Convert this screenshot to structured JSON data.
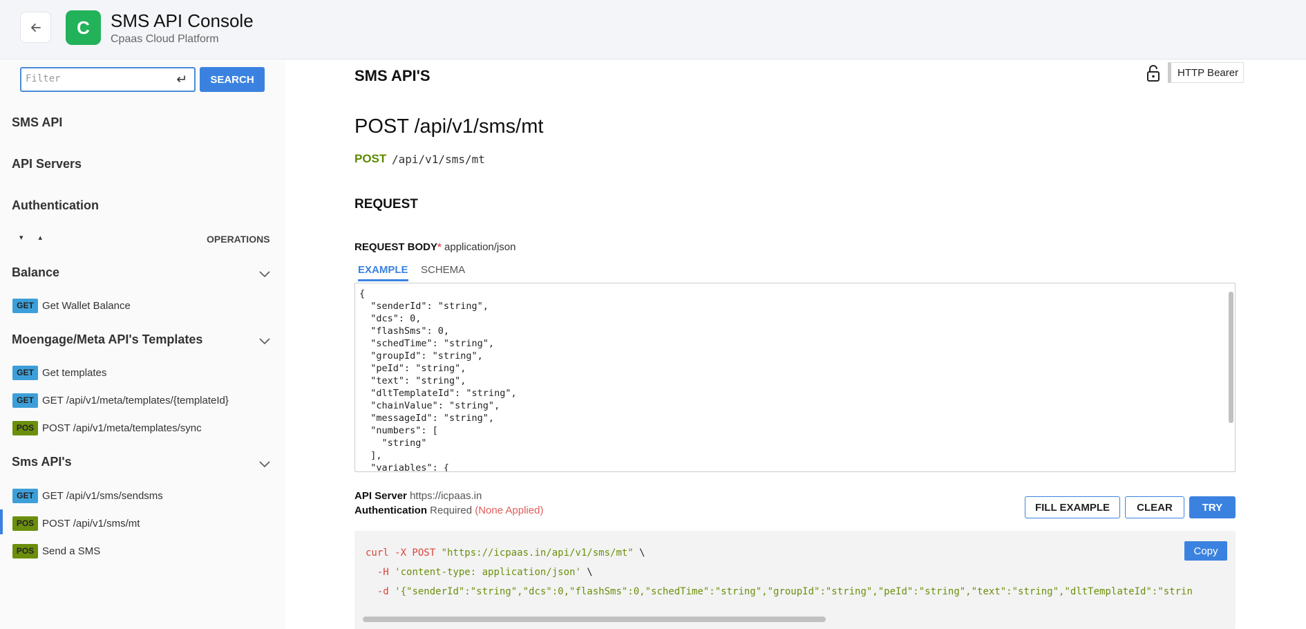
{
  "header": {
    "back_icon": "arrow-left-icon",
    "logo_letter": "C",
    "title": "SMS API Console",
    "subtitle": "Cpaas Cloud Platform"
  },
  "sidebar": {
    "filter_placeholder": "Filter",
    "search_label": "SEARCH",
    "nav": [
      "SMS API",
      "API Servers",
      "Authentication"
    ],
    "expand_all": "▾",
    "collapse_all": "▴",
    "operations_label": "OPERATIONS",
    "groups": [
      {
        "title": "Balance",
        "ops": [
          {
            "method": "GET",
            "label": "Get Wallet Balance"
          }
        ]
      },
      {
        "title": "Moengage/Meta API's Templates",
        "ops": [
          {
            "method": "GET",
            "label": "Get templates"
          },
          {
            "method": "GET",
            "label": "GET /api/v1/meta/templates/{templateId}"
          },
          {
            "method": "POS",
            "label": "POST /api/v1/meta/templates/sync"
          }
        ]
      },
      {
        "title": "Sms API's",
        "ops": [
          {
            "method": "GET",
            "label": "GET /api/v1/sms/sendsms"
          },
          {
            "method": "POS",
            "label": "POST /api/v1/sms/mt",
            "active": true
          },
          {
            "method": "POS",
            "label": "Send a SMS"
          }
        ]
      }
    ]
  },
  "main": {
    "section_title": "SMS API'S",
    "auth_chip": "HTTP Bearer",
    "endpoint_title": "POST /api/v1/sms/mt",
    "method": "POST",
    "path": "/api/v1/sms/mt",
    "request_title": "REQUEST",
    "request_body_label": "REQUEST BODY",
    "required_mark": "*",
    "content_type": "application/json",
    "tabs": [
      "EXAMPLE",
      "SCHEMA"
    ],
    "example_body": "{\n  \"senderId\": \"string\",\n  \"dcs\": 0,\n  \"flashSms\": 0,\n  \"schedTime\": \"string\",\n  \"groupId\": \"string\",\n  \"peId\": \"string\",\n  \"text\": \"string\",\n  \"dltTemplateId\": \"string\",\n  \"chainValue\": \"string\",\n  \"messageId\": \"string\",\n  \"numbers\": [\n    \"string\"\n  ],\n  \"variables\": {",
    "api_server_label": "API Server",
    "api_server_value": "https://icpaas.in",
    "authentication_label": "Authentication",
    "authentication_required": "Required",
    "authentication_status": "(None Applied)",
    "buttons": {
      "fill_example": "FILL EXAMPLE",
      "clear": "CLEAR",
      "try": "TRY"
    },
    "curl": {
      "cmd": "curl",
      "line1_flag": " -X POST ",
      "line1_url": "\"https://icpaas.in/api/v1/sms/mt\"",
      "line1_end": " \\",
      "line2_flag": "  -H ",
      "line2_value": "'content-type: application/json'",
      "line2_end": " \\",
      "line3_flag": "  -d ",
      "line3_value": "'{\"senderId\":\"string\",\"dcs\":0,\"flashSms\":0,\"schedTime\":\"string\",\"groupId\":\"string\",\"peId\":\"string\",\"text\":\"string\",\"dltTemplateId\":\"strin",
      "copy_label": "Copy"
    }
  },
  "colors": {
    "accent": "#3b82e0",
    "get_badge": "#3d9fd9",
    "post_badge": "#6b8f0c",
    "logo": "#21b25a",
    "error": "#e05c5c"
  }
}
